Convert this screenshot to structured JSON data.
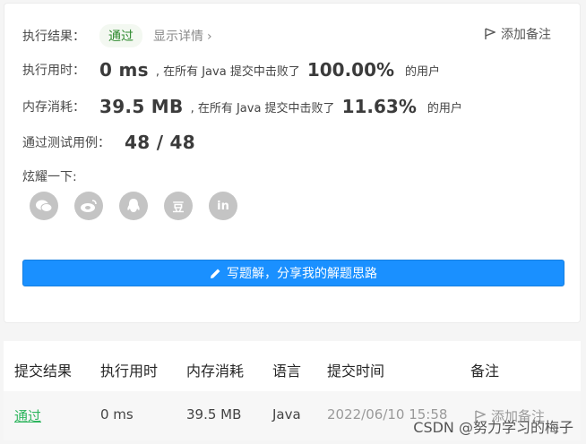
{
  "summary": {
    "result_label": "执行结果：",
    "status": "通过",
    "details_link": "显示详情",
    "add_note": "添加备注"
  },
  "runtime": {
    "label": "执行用时：",
    "value": "0 ms",
    "middle": ", 在所有 Java 提交中击败了",
    "percent": "100.00%",
    "tail": "的用户"
  },
  "memory": {
    "label": "内存消耗：",
    "value": "39.5 MB",
    "middle": ", 在所有 Java 提交中击败了",
    "percent": "11.63%",
    "tail": "的用户"
  },
  "tests": {
    "label": "通过测试用例：",
    "value": "48 / 48"
  },
  "share": {
    "label": "炫耀一下:",
    "icons": [
      "wechat-icon",
      "weibo-icon",
      "qq-icon",
      "douban-icon",
      "linkedin-icon"
    ],
    "douban_glyph": "豆",
    "linkedin_glyph": "in"
  },
  "write_button": "写题解，分享我的解题思路",
  "table": {
    "headers": [
      "提交结果",
      "执行用时",
      "内存消耗",
      "语言",
      "提交时间",
      "备注"
    ],
    "row": {
      "result": "通过",
      "runtime": "0 ms",
      "memory": "39.5 MB",
      "language": "Java",
      "time": "2022/06/10 15:58",
      "note": "添加备注"
    }
  },
  "watermark": "CSDN @努力学习的梅子",
  "colors": {
    "accent": "#1a90ff",
    "success": "#2db55d"
  }
}
